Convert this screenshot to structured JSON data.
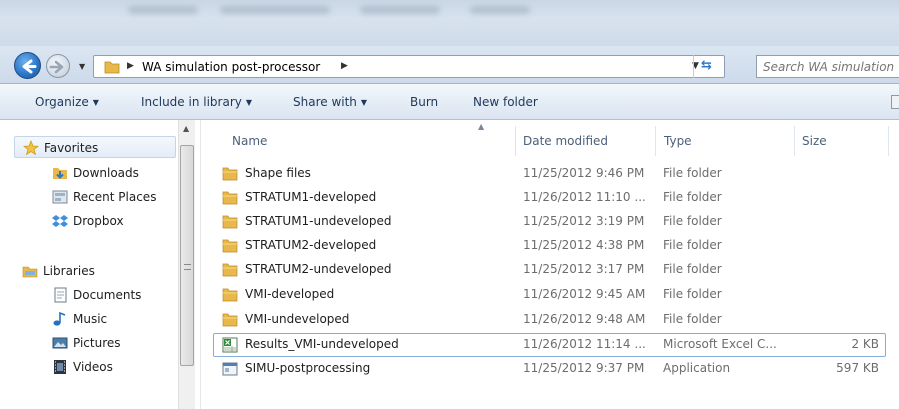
{
  "window": {
    "search_placeholder": "Search WA simulation"
  },
  "address": {
    "path": "WA simulation post-processor"
  },
  "toolbar": {
    "organize": "Organize",
    "include_in_library": "Include in library",
    "share_with": "Share with",
    "burn": "Burn",
    "new_folder": "New folder"
  },
  "nav": {
    "favorites": {
      "label": "Favorites",
      "items": [
        {
          "label": "Downloads",
          "icon": "downloads-icon"
        },
        {
          "label": "Recent Places",
          "icon": "recent-places-icon"
        },
        {
          "label": "Dropbox",
          "icon": "dropbox-icon"
        }
      ]
    },
    "libraries": {
      "label": "Libraries",
      "items": [
        {
          "label": "Documents",
          "icon": "documents-icon"
        },
        {
          "label": "Music",
          "icon": "music-icon"
        },
        {
          "label": "Pictures",
          "icon": "pictures-icon"
        },
        {
          "label": "Videos",
          "icon": "videos-icon"
        }
      ]
    }
  },
  "columns": {
    "name": "Name",
    "date": "Date modified",
    "type": "Type",
    "size": "Size"
  },
  "files": [
    {
      "name": "Shape files",
      "date": "11/25/2012 9:46 PM",
      "type": "File folder",
      "size": "",
      "icon": "folder-icon"
    },
    {
      "name": "STRATUM1-developed",
      "date": "11/26/2012 11:10 ...",
      "type": "File folder",
      "size": "",
      "icon": "folder-icon"
    },
    {
      "name": "STRATUM1-undeveloped",
      "date": "11/25/2012 3:19 PM",
      "type": "File folder",
      "size": "",
      "icon": "folder-icon"
    },
    {
      "name": "STRATUM2-developed",
      "date": "11/25/2012 4:38 PM",
      "type": "File folder",
      "size": "",
      "icon": "folder-icon"
    },
    {
      "name": "STRATUM2-undeveloped",
      "date": "11/25/2012 3:17 PM",
      "type": "File folder",
      "size": "",
      "icon": "folder-icon"
    },
    {
      "name": "VMI-developed",
      "date": "11/26/2012 9:45 AM",
      "type": "File folder",
      "size": "",
      "icon": "folder-icon"
    },
    {
      "name": "VMI-undeveloped",
      "date": "11/26/2012 9:48 AM",
      "type": "File folder",
      "size": "",
      "icon": "folder-icon"
    },
    {
      "name": "Results_VMI-undeveloped",
      "date": "11/26/2012 11:14 ...",
      "type": "Microsoft Excel C...",
      "size": "2 KB",
      "icon": "excel-csv-icon"
    },
    {
      "name": "SIMU-postprocessing",
      "date": "11/25/2012 9:37 PM",
      "type": "Application",
      "size": "597 KB",
      "icon": "application-icon"
    }
  ],
  "colors": {
    "accent": "#2d78c9",
    "folder": "#e8b84a",
    "selection_border": "#84acdd",
    "toolbar_text": "#1e395b"
  }
}
